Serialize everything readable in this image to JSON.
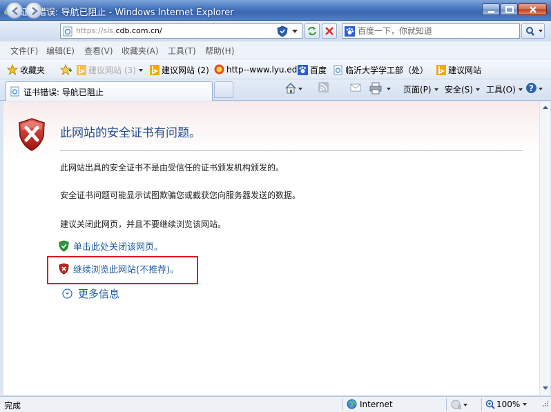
{
  "window": {
    "title": "证书错误: 导航已阻止 - Windows Internet Explorer"
  },
  "address": {
    "url_prefix": "https://sls.",
    "url_domain": "cdb.com.cn/"
  },
  "search": {
    "placeholder": "百度一下，你就知道"
  },
  "menu": [
    "文件(F)",
    "编辑(E)",
    "查看(V)",
    "收藏夹(A)",
    "工具(T)",
    "帮助(H)"
  ],
  "favorites": {
    "label": "收藏夹",
    "items": [
      {
        "label": "建议网站 (3)",
        "icon": "bing-icon",
        "dim": true
      },
      {
        "label": "建议网站 (2)",
        "icon": "bing-icon"
      },
      {
        "label": "http--www.lyu.edu",
        "icon": "site-icon"
      },
      {
        "label": "百度",
        "icon": "baidu-icon"
      },
      {
        "label": "临沂大学学工部（处）",
        "icon": "page-icon"
      },
      {
        "label": "建议网站",
        "icon": "bing-icon"
      }
    ]
  },
  "tab": {
    "title": "证书错误: 导航已阻止"
  },
  "commands": {
    "page": "页面(P)",
    "safety": "安全(S)",
    "tools": "工具(O)"
  },
  "error_page": {
    "heading": "此网站的安全证书有问题。",
    "para1": "此网站出具的安全证书不是由受信任的证书颁发机构颁发的。",
    "para2": "安全证书问题可能显示试图欺骗您或截获您向服务器发送的数据。",
    "para3": "建议关闭此网页，并且不要继续浏览该网站。",
    "close_link": "单击此处关闭该网页。",
    "continue_link": "继续浏览此网站(不推荐)。",
    "more_info": "更多信息"
  },
  "status": {
    "text": "完成",
    "zone": "Internet",
    "zoom": "100%"
  },
  "colors": {
    "heading": "#1f4e8c",
    "link": "#1c5aa0",
    "highlight_box": "#e0161c"
  }
}
